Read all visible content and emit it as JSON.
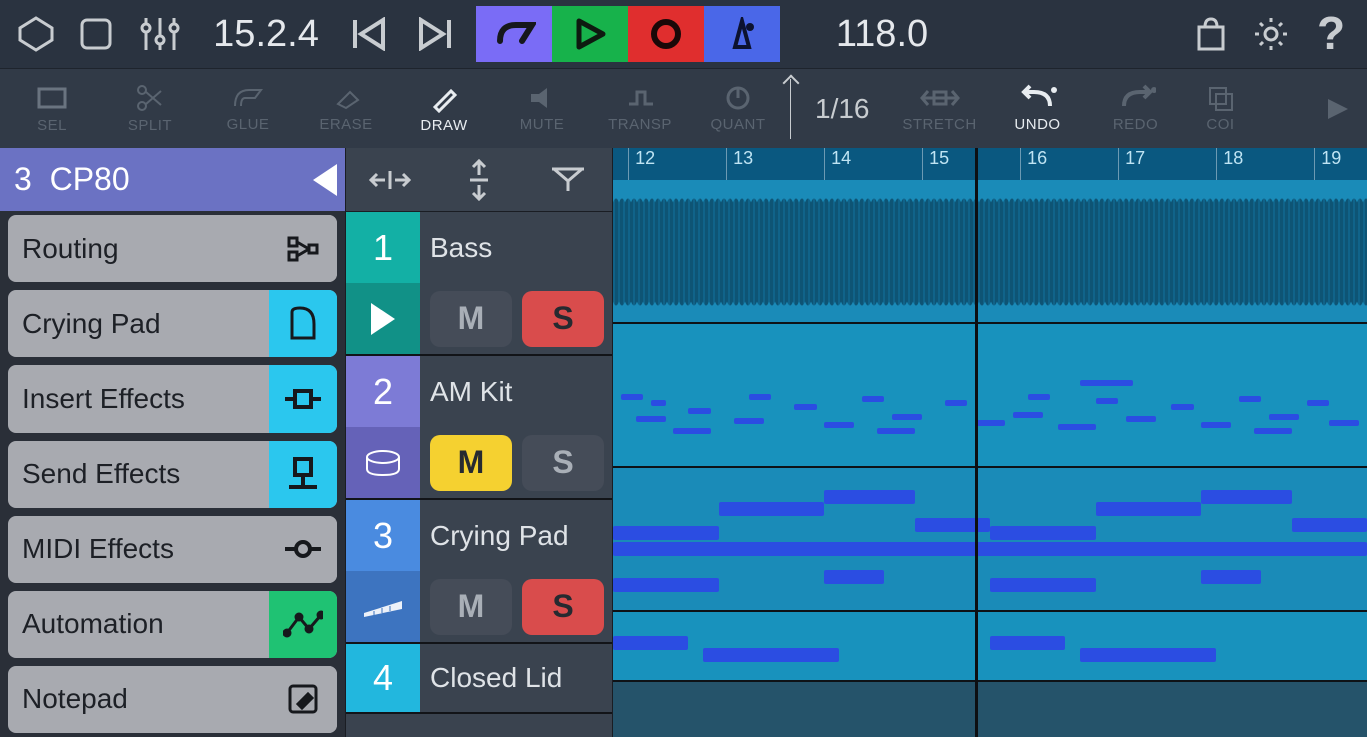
{
  "top": {
    "position": "15.2.4",
    "tempo": "118.0"
  },
  "tools": {
    "items": [
      {
        "label": "SEL",
        "active": false
      },
      {
        "label": "SPLIT",
        "active": false
      },
      {
        "label": "GLUE",
        "active": false
      },
      {
        "label": "ERASE",
        "active": false
      },
      {
        "label": "DRAW",
        "active": true
      },
      {
        "label": "MUTE",
        "active": false
      },
      {
        "label": "TRANSP",
        "active": false
      },
      {
        "label": "QUANT",
        "active": false
      }
    ],
    "snap": "1/16",
    "stretch": "STRETCH",
    "undo": "UNDO",
    "redo": "REDO",
    "copy": "COI"
  },
  "sidebar": {
    "head_num": "3",
    "head_name": "CP80",
    "items": [
      {
        "label": "Routing",
        "iconColor": "gray",
        "icon": "routing"
      },
      {
        "label": "Crying Pad",
        "iconColor": "cyan",
        "icon": "piano"
      },
      {
        "label": "Insert Effects",
        "iconColor": "cyan",
        "icon": "insert"
      },
      {
        "label": "Send Effects",
        "iconColor": "cyan",
        "icon": "send"
      },
      {
        "label": "MIDI Effects",
        "iconColor": "gray",
        "icon": "midi"
      },
      {
        "label": "Automation",
        "iconColor": "green",
        "icon": "automation"
      },
      {
        "label": "Notepad",
        "iconColor": "gray",
        "icon": "notepad"
      }
    ]
  },
  "tracks": [
    {
      "num": "1",
      "name": "Bass",
      "color": "#13b0a5",
      "color2": "#119187",
      "mute": false,
      "solo": true,
      "showPlay": true,
      "icon": "play"
    },
    {
      "num": "2",
      "name": "AM Kit",
      "color": "#7d7bd6",
      "color2": "#6562b8",
      "mute": true,
      "solo": false,
      "icon": "drum"
    },
    {
      "num": "3",
      "name": "Crying Pad",
      "color": "#4a8be0",
      "color2": "#3d74c0",
      "mute": false,
      "solo": true,
      "icon": "keys"
    },
    {
      "num": "4",
      "name": "Closed Lid",
      "color": "#22b7de",
      "color2": "#1b9abc",
      "mute": false,
      "solo": false
    }
  ],
  "ruler": {
    "bars": [
      "12",
      "13",
      "14",
      "15",
      "16",
      "17",
      "18",
      "19"
    ]
  },
  "labels": {
    "m": "M",
    "s": "S"
  }
}
